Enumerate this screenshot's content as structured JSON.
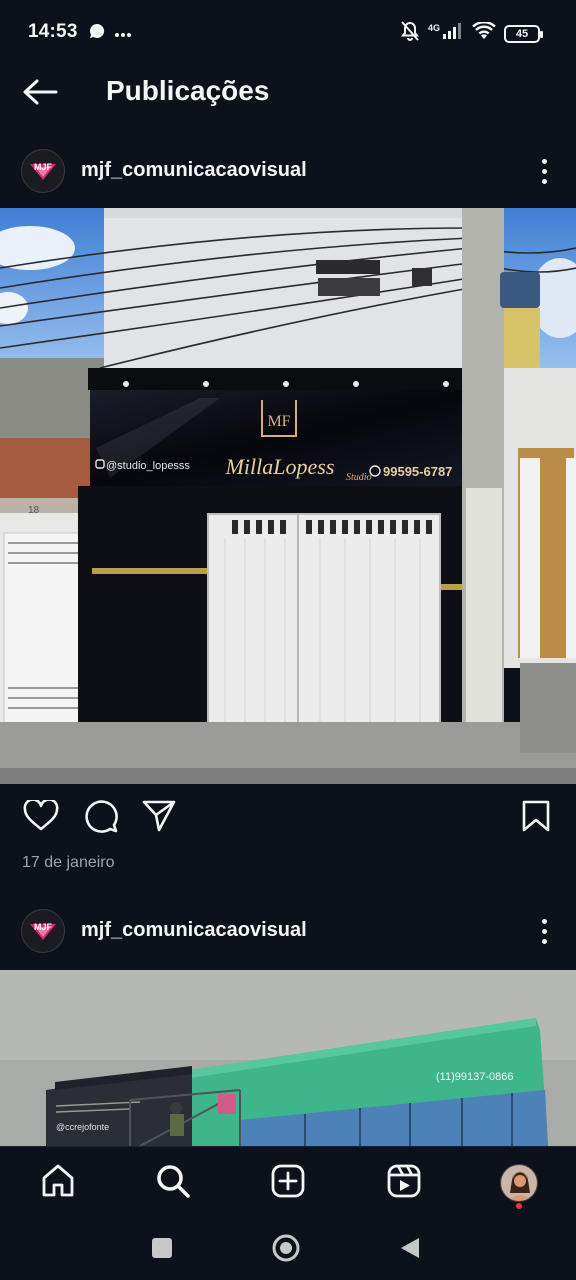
{
  "status_bar": {
    "time": "14:53",
    "icons": [
      "whatsapp-icon",
      "more-dots-icon",
      "mute-icon",
      "signal-icon",
      "wifi-icon"
    ],
    "network": "4G",
    "battery": "45"
  },
  "header": {
    "title": "Publicações",
    "back_icon": "arrow-left-icon"
  },
  "posts": [
    {
      "username": "mjf_comunicacaovisual",
      "date": "17 de janeiro",
      "sign": {
        "handle": "@studio_lopesss",
        "brand": "MillaLopess",
        "brand_sub": "Studio",
        "phone": "99595-6787",
        "monogram": "MF"
      },
      "house_number": "18"
    },
    {
      "username": "mjf_comunicacaovisual",
      "sign": {
        "phone": "(11)99137-0866",
        "handle": "@ccrejofonte"
      }
    }
  ],
  "actions": [
    "heart-icon",
    "comment-icon",
    "share-icon",
    "bookmark-icon"
  ],
  "bottom_nav": [
    "home-icon",
    "search-icon",
    "create-post-icon",
    "reels-icon",
    "profile-avatar"
  ],
  "system_nav": [
    "recents-button",
    "home-button",
    "back-button"
  ],
  "colors": {
    "background": "#0c111b",
    "text": "#f5f5f5",
    "muted_text": "#a0a3ab",
    "notification": "#ff3040",
    "facade_green": "#3fb58c"
  }
}
